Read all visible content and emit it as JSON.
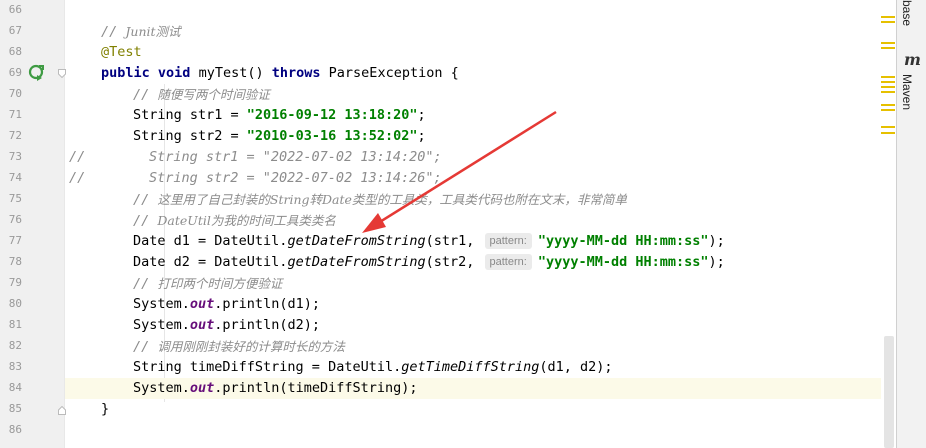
{
  "editor": {
    "lines": [
      {
        "n": "66"
      },
      {
        "n": "67",
        "c1": "// ",
        "c2": "Junit测试"
      },
      {
        "n": "68",
        "ann": "@Test"
      },
      {
        "n": "69",
        "kw1": "public",
        "kw2": "void",
        "name": "myTest()",
        "kw3": "throws",
        "rest": "ParseException {"
      },
      {
        "n": "70",
        "c1": "// ",
        "c2": "随便写两个时间验证"
      },
      {
        "n": "71",
        "pre": "String str1 = ",
        "s": "\"2016-09-12 13:18:20\"",
        "post": ";"
      },
      {
        "n": "72",
        "pre": "String str2 = ",
        "s": "\"2010-03-16 13:52:02\"",
        "post": ";"
      },
      {
        "n": "73",
        "lc": "//",
        "c": "String str1 = \"2022-07-02 13:14:20\";"
      },
      {
        "n": "74",
        "lc": "//",
        "c": "String str2 = \"2022-07-02 13:14:26\";"
      },
      {
        "n": "75",
        "c1": "// ",
        "c2": "这里用了自己封装的String转Date类型的工具类，工具类代码也附在文末，非常简单"
      },
      {
        "n": "76",
        "c1": "// ",
        "c2": "DateUtil为我的时间工具类类名"
      },
      {
        "n": "77",
        "pre": "Date d1 = DateUtil.",
        "m": "getDateFromString",
        "arg": "(str1, ",
        "hint": "pattern:",
        "s": "\"yyyy-MM-dd HH:mm:ss\"",
        "post": ");"
      },
      {
        "n": "78",
        "pre": "Date d2 = DateUtil.",
        "m": "getDateFromString",
        "arg": "(str2, ",
        "hint": "pattern:",
        "s": "\"yyyy-MM-dd HH:mm:ss\"",
        "post": ");"
      },
      {
        "n": "79",
        "c1": "// ",
        "c2": "打印两个时间方便验证"
      },
      {
        "n": "80",
        "pre": "System.",
        "st": "out",
        "post": ".println(d1);"
      },
      {
        "n": "81",
        "pre": "System.",
        "st": "out",
        "post": ".println(d2);"
      },
      {
        "n": "82",
        "c1": "// ",
        "c2": "调用刚刚封装好的计算时长的方法"
      },
      {
        "n": "83",
        "pre": "String timeDiffString = DateUtil.",
        "m": "getTimeDiffString",
        "post": "(d1, d2);"
      },
      {
        "n": "84",
        "pre": "System.",
        "st": "out",
        "post": ".println(timeDiffString);"
      },
      {
        "n": "85",
        "close": "}"
      },
      {
        "n": "86"
      }
    ]
  },
  "right_panel": {
    "tab_database": "base",
    "tab_maven": "Maven",
    "maven_icon_glyph": "m"
  },
  "colors": {
    "keyword": "#000080",
    "string": "#008000",
    "comment": "#8c8c8c",
    "annotation": "#808000",
    "arrow": "#e53935"
  }
}
